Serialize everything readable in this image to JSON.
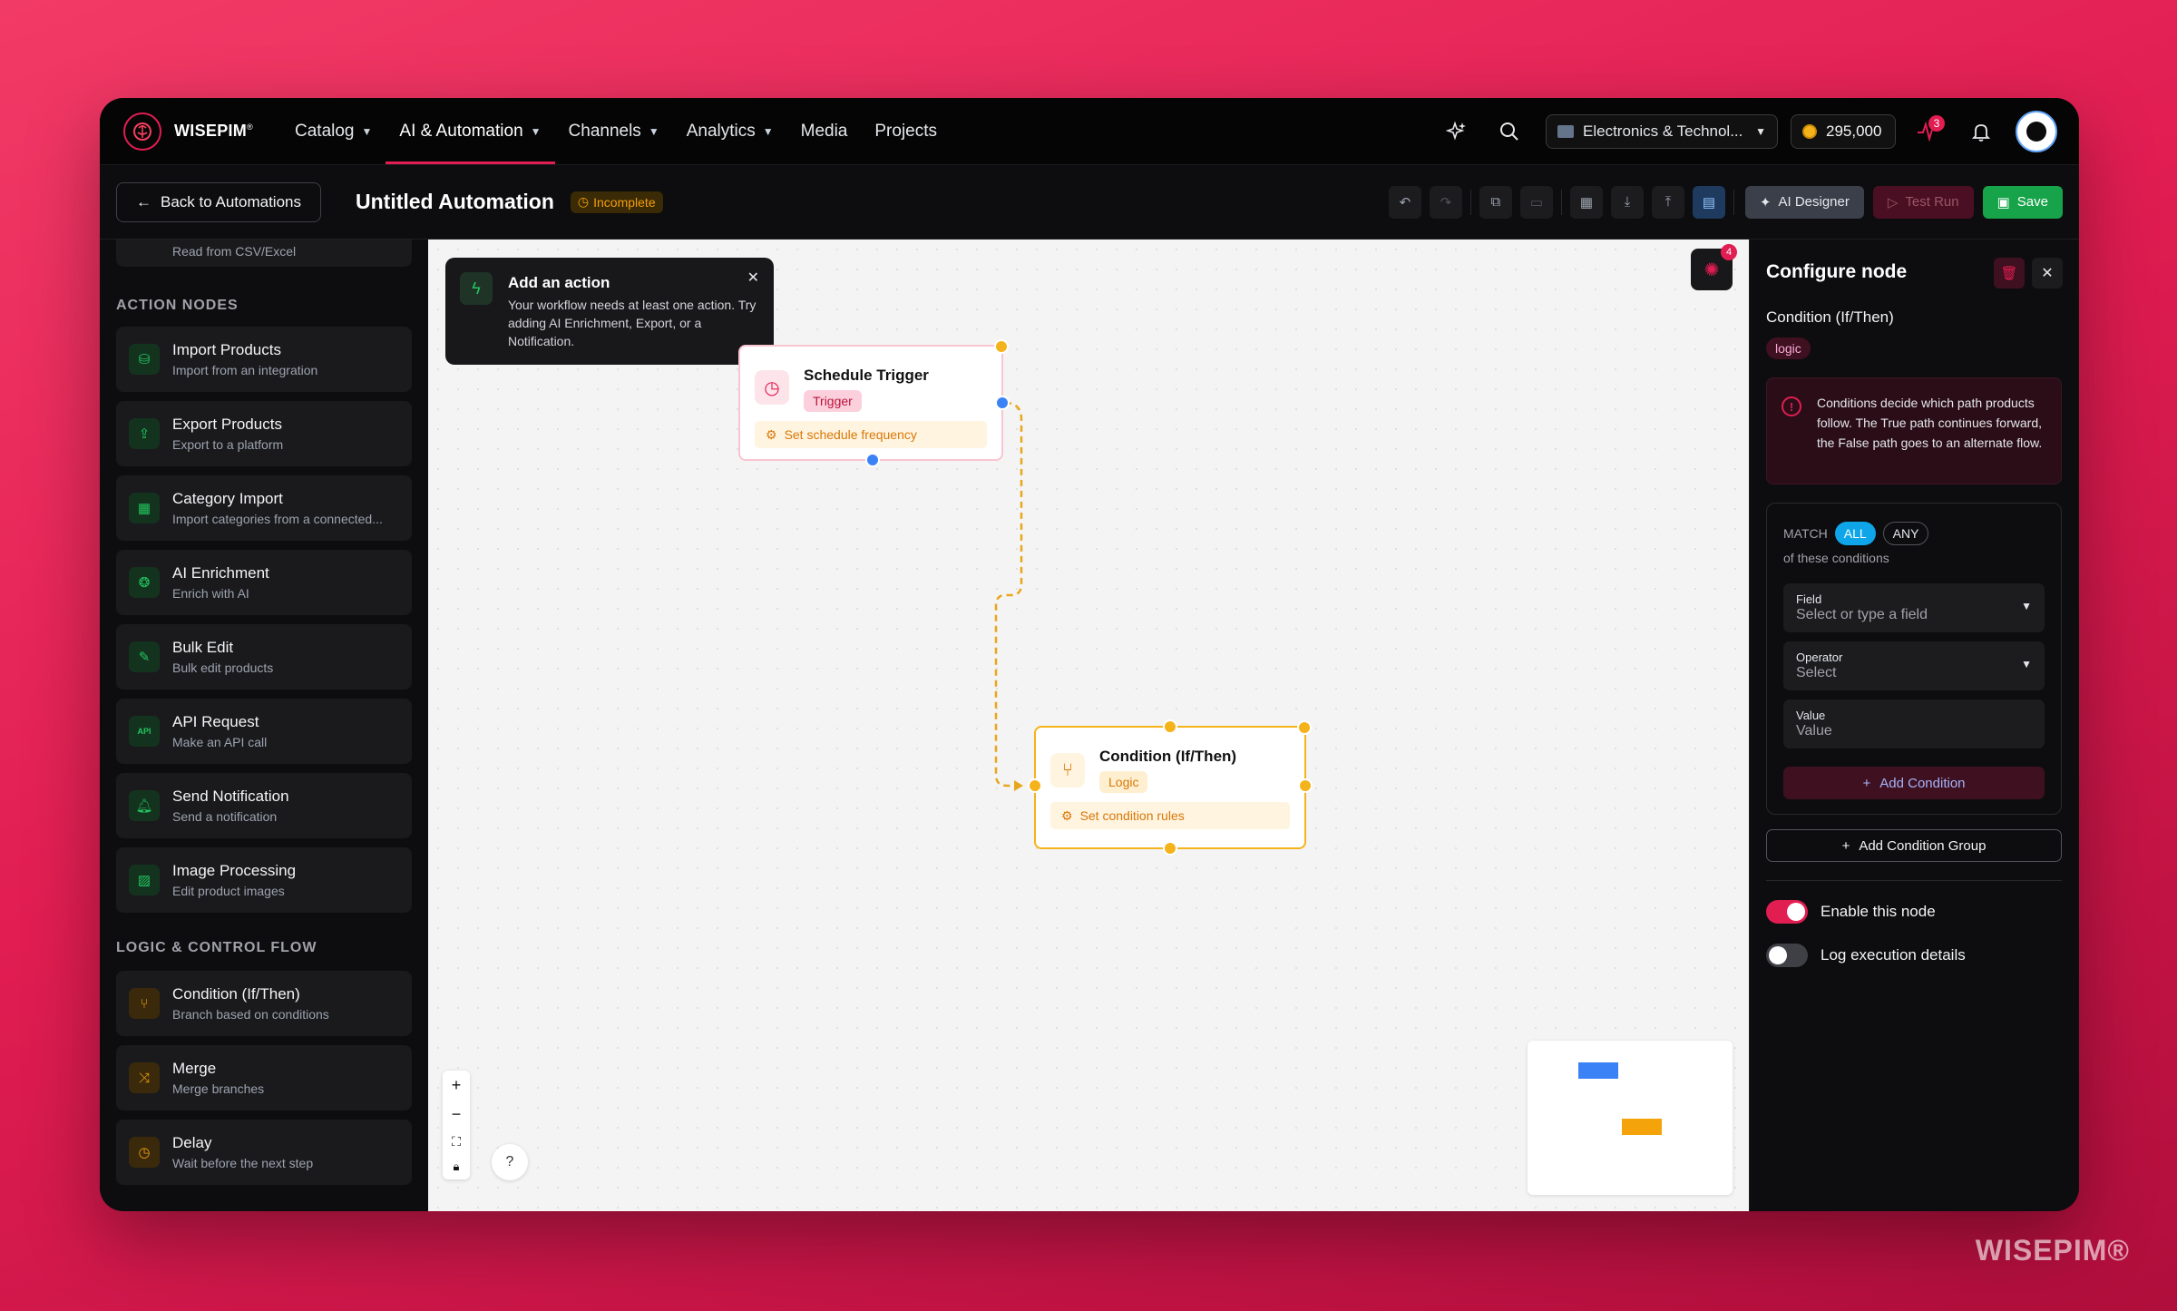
{
  "app": {
    "name": "WISEPIM",
    "registered": "®",
    "watermark": "WISEPIM®"
  },
  "nav": {
    "items": [
      {
        "label": "Catalog",
        "has_menu": true
      },
      {
        "label": "AI & Automation",
        "has_menu": true,
        "active": true
      },
      {
        "label": "Channels",
        "has_menu": true
      },
      {
        "label": "Analytics",
        "has_menu": true
      },
      {
        "label": "Media",
        "has_menu": false
      },
      {
        "label": "Projects",
        "has_menu": false
      }
    ],
    "store_selector": "Electronics & Technol...",
    "credits": "295,000",
    "activity_badge": "3"
  },
  "toolbar": {
    "back_label": "Back to Automations",
    "title": "Untitled Automation",
    "status": "Incomplete",
    "ai_designer": "AI Designer",
    "test_run": "Test Run",
    "save": "Save"
  },
  "sidebar": {
    "partial_item_sub": "Read from CSV/Excel",
    "action_heading": "ACTION NODES",
    "action_nodes": [
      {
        "title": "Import Products",
        "sub": "Import from an integration",
        "icon": "database-icon"
      },
      {
        "title": "Export Products",
        "sub": "Export to a platform",
        "icon": "export-icon"
      },
      {
        "title": "Category Import",
        "sub": "Import categories from a connected...",
        "icon": "grid-icon"
      },
      {
        "title": "AI Enrichment",
        "sub": "Enrich with AI",
        "icon": "brain-icon"
      },
      {
        "title": "Bulk Edit",
        "sub": "Bulk edit products",
        "icon": "edit-icon"
      },
      {
        "title": "API Request",
        "sub": "Make an API call",
        "icon": "api-icon"
      },
      {
        "title": "Send Notification",
        "sub": "Send a notification",
        "icon": "bell-icon"
      },
      {
        "title": "Image Processing",
        "sub": "Edit product images",
        "icon": "image-icon"
      }
    ],
    "logic_heading": "LOGIC & CONTROL FLOW",
    "logic_nodes": [
      {
        "title": "Condition (If/Then)",
        "sub": "Branch based on conditions",
        "icon": "branch-icon"
      },
      {
        "title": "Merge",
        "sub": "Merge branches",
        "icon": "merge-icon"
      },
      {
        "title": "Delay",
        "sub": "Wait before the next step",
        "icon": "clock-icon"
      }
    ]
  },
  "canvas": {
    "tooltip": {
      "title": "Add an action",
      "body": "Your workflow needs at least one action. Try adding AI Enrichment, Export, or a Notification."
    },
    "trigger_node": {
      "title": "Schedule Trigger",
      "tag": "Trigger",
      "hint": "Set schedule frequency"
    },
    "condition_node": {
      "title": "Condition (If/Then)",
      "tag": "Logic",
      "hint": "Set condition rules"
    },
    "suggestions_badge": "4",
    "colors": {
      "trigger_accent": "#e11d52",
      "condition_accent": "#f5b31b",
      "edge": "#e8a61c",
      "handle_blue": "#3b82f6"
    }
  },
  "panel": {
    "title": "Configure node",
    "node_name": "Condition (If/Then)",
    "node_tag": "logic",
    "info": "Conditions decide which path products follow. The True path continues forward, the False path goes to an alternate flow.",
    "match_label": "MATCH",
    "match_all": "ALL",
    "match_any": "ANY",
    "match_sub": "of these conditions",
    "field": {
      "label": "Field",
      "placeholder": "Select or type a field"
    },
    "operator": {
      "label": "Operator",
      "placeholder": "Select"
    },
    "value": {
      "label": "Value",
      "placeholder": "Value"
    },
    "add_condition": "Add Condition",
    "add_group": "Add Condition Group",
    "enable_label": "Enable this node",
    "enable_on": true,
    "log_label": "Log execution details",
    "log_on": false
  }
}
